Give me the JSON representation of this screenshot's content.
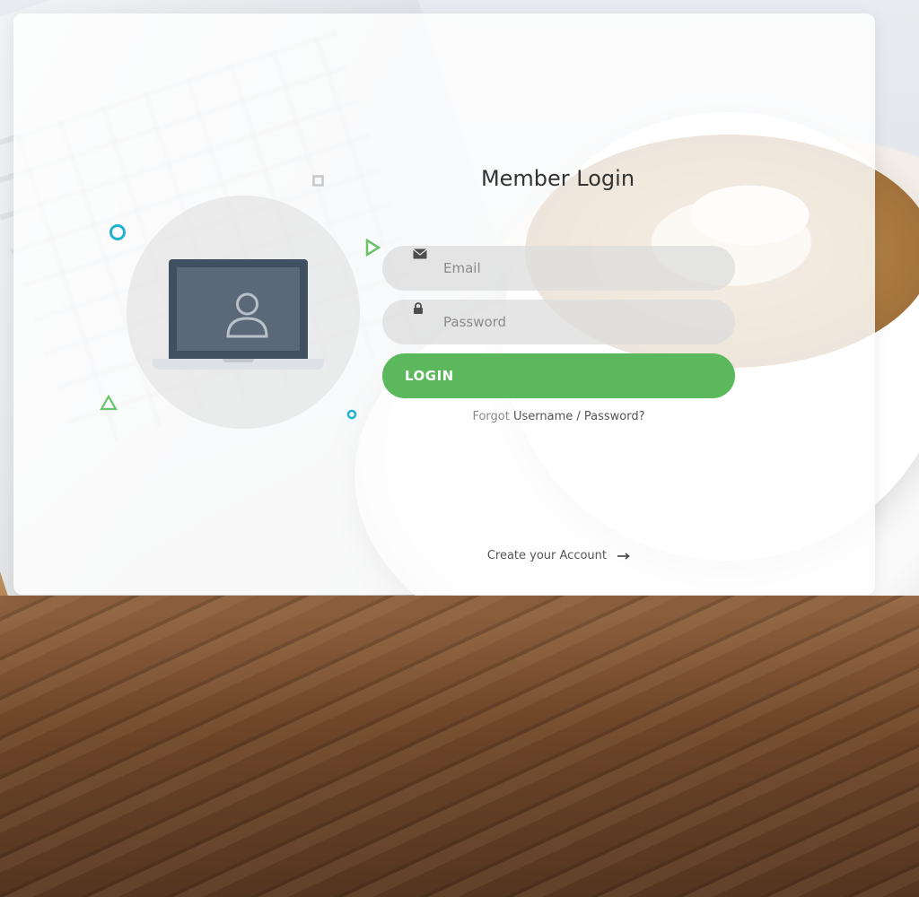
{
  "login_form": {
    "title": "Member Login",
    "email_placeholder": "Email",
    "password_placeholder": "Password",
    "login_button": "LOGIN",
    "forgot_prefix": "Forgot",
    "forgot_link": "Username / Password?",
    "create_account": "Create your Account"
  },
  "icons": {
    "email": "envelope-icon",
    "password": "lock-icon",
    "create_account_arrow": "arrow-right-icon",
    "illustration": "user-icon"
  },
  "colors": {
    "accent_green": "#5cb85c",
    "decor_blue": "#20b2d2",
    "decor_green": "#6bc36b",
    "card_overlay": "#ffffff",
    "laptop_dark": "#415061"
  }
}
